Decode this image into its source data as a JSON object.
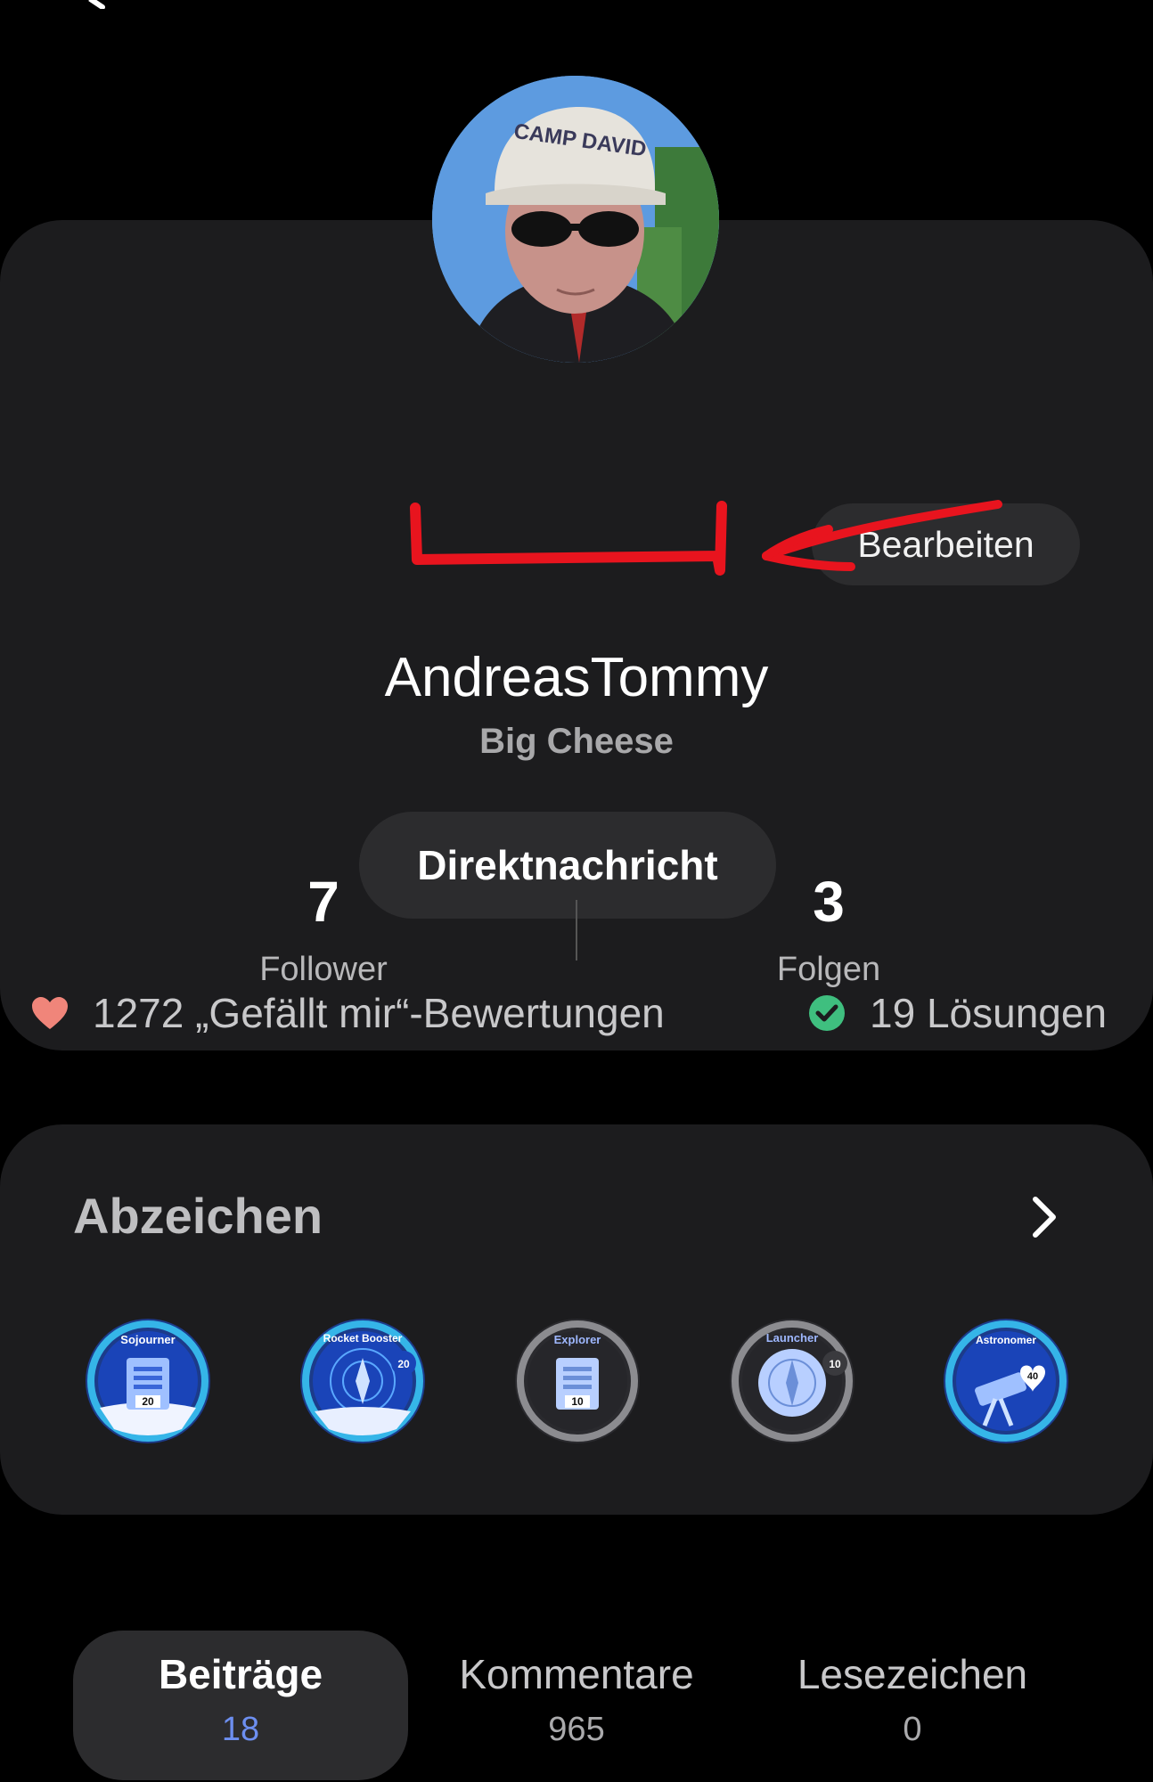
{
  "profile": {
    "username": "AndreasTommy",
    "rank": "Big Cheese",
    "edit_label": "Bearbeiten",
    "dm_label": "Direktnachricht",
    "avatar_cap_text": "CAMP DAVID"
  },
  "stats": {
    "likes_text": "1272 „Gefällt mir“-Bewertungen",
    "solutions_text": "19 Lösungen",
    "followers_count": "7",
    "followers_label": "Follower",
    "following_count": "3",
    "following_label": "Folgen"
  },
  "badges": {
    "title": "Abzeichen",
    "items": [
      {
        "name": "Sojourner",
        "level": "20"
      },
      {
        "name": "Rocket Booster",
        "level": "20"
      },
      {
        "name": "Explorer",
        "level": "10"
      },
      {
        "name": "Launcher",
        "level": "10"
      },
      {
        "name": "Astronomer",
        "level": "40"
      }
    ]
  },
  "tabs": [
    {
      "label": "Beiträge",
      "count": "18",
      "active": true
    },
    {
      "label": "Kommentare",
      "count": "965",
      "active": false
    },
    {
      "label": "Lesezeichen",
      "count": "0",
      "active": false
    }
  ],
  "colors": {
    "background": "#000000",
    "card": "#1c1c1e",
    "button": "#2c2c2e",
    "heart": "#f0857a",
    "check": "#3fbf7f",
    "accent_blue": "#6d8ff0",
    "annotation_red": "#e8141e"
  },
  "icons": [
    "back-arrow-icon",
    "heart-icon",
    "check-circle-icon",
    "chevron-right-icon"
  ]
}
